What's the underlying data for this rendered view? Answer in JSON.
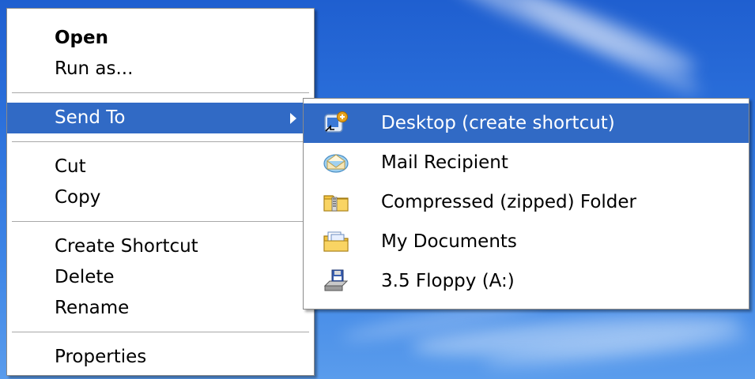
{
  "context_menu": {
    "items": [
      {
        "label": "Open"
      },
      {
        "label": "Run as..."
      },
      {
        "label": "Send To"
      },
      {
        "label": "Cut"
      },
      {
        "label": "Copy"
      },
      {
        "label": "Create Shortcut"
      },
      {
        "label": "Delete"
      },
      {
        "label": "Rename"
      },
      {
        "label": "Properties"
      }
    ]
  },
  "send_to_menu": {
    "items": [
      {
        "label": "Desktop (create shortcut)",
        "icon": "desktop-shortcut-icon"
      },
      {
        "label": "Mail Recipient",
        "icon": "mail-recipient-icon"
      },
      {
        "label": "Compressed (zipped) Folder",
        "icon": "zip-folder-icon"
      },
      {
        "label": "My Documents",
        "icon": "my-documents-icon"
      },
      {
        "label": "3.5 Floppy (A:)",
        "icon": "floppy-drive-icon"
      }
    ]
  },
  "colors": {
    "highlight": "#316ac5",
    "menu_background": "#ffffff",
    "desktop_blue": "#2d72dc"
  }
}
